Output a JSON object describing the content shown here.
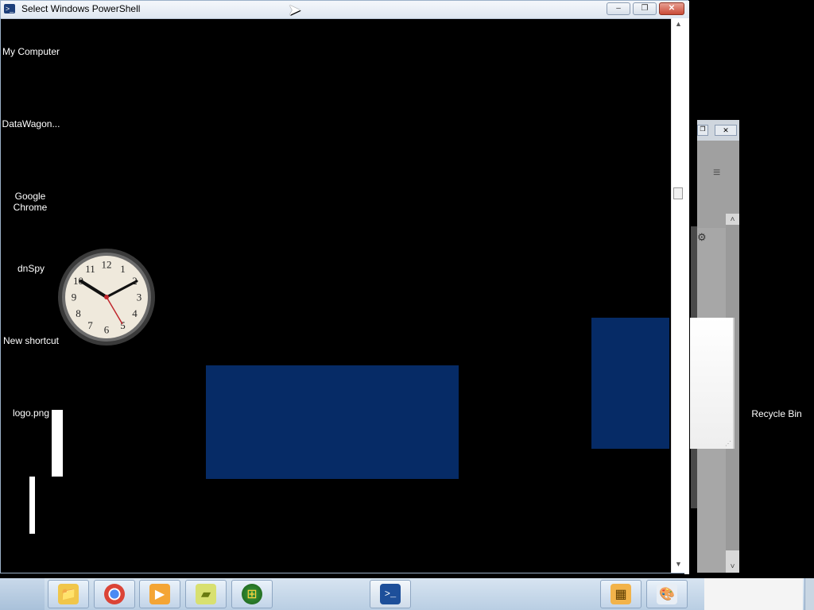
{
  "window": {
    "title": "Select Windows PowerShell",
    "icon": ">_",
    "minimize_glyph": "–",
    "maximize_glyph": "❐",
    "close_glyph": "✕"
  },
  "desktop_icons": [
    {
      "label": "My Computer"
    },
    {
      "label": "DataWagon..."
    },
    {
      "label": "Google Chrome"
    },
    {
      "label": "dnSpy"
    },
    {
      "label": "New shortcut"
    },
    {
      "label": "logo.png"
    },
    {
      "label": "Recycle Bin"
    }
  ],
  "clock": {
    "hour_numbers": [
      "12",
      "1",
      "2",
      "3",
      "4",
      "5",
      "6",
      "7",
      "8",
      "9",
      "10",
      "11"
    ]
  },
  "background_window": {
    "restore_glyph": "❐",
    "close_glyph": "✕",
    "menu_glyph": "≡",
    "gear_glyph": "⚙"
  },
  "taskbar": {
    "items": [
      {
        "name": "explorer",
        "glyph": "📁"
      },
      {
        "name": "chrome",
        "glyph": "◉"
      },
      {
        "name": "media-player",
        "glyph": "▶"
      },
      {
        "name": "sticky-notes",
        "glyph": "▰"
      },
      {
        "name": "windows-start",
        "glyph": "⊞"
      },
      {
        "name": "powershell",
        "glyph": ">_"
      },
      {
        "name": "calculator",
        "glyph": "▦"
      },
      {
        "name": "paint",
        "glyph": "🎨"
      }
    ]
  },
  "colors": {
    "desktop": "#000000",
    "blue_rect": "#062b66",
    "taskbar": "#c5d6e8"
  }
}
